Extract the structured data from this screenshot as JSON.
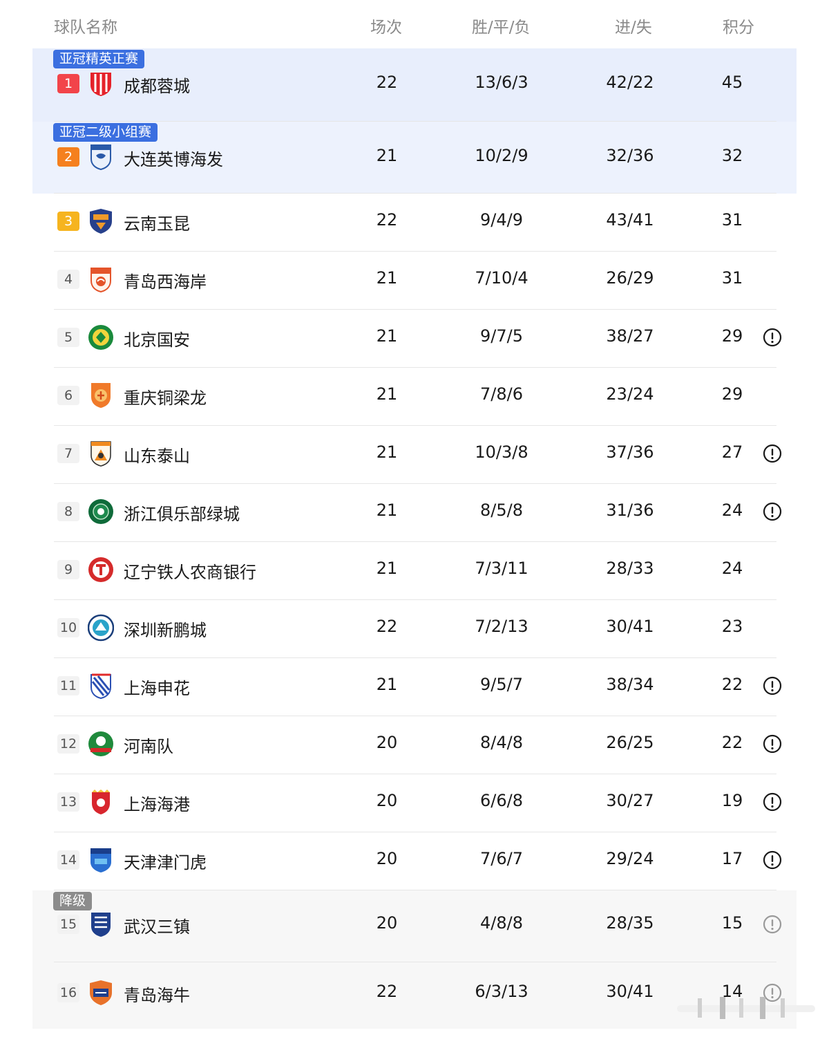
{
  "header": {
    "team": "球队名称",
    "played": "场次",
    "wdl": "胜/平/负",
    "goals": "进/失",
    "points": "积分"
  },
  "colors": {
    "acl_elite_bg": "#e8eefc",
    "acl_two_bg": "#edf2fd",
    "relegation_bg": "#f7f7f7",
    "tag_blue": "#3b6fe0",
    "tag_gray": "#8c8c8c",
    "rank1": "#f2444a",
    "rank2": "#f5801e",
    "rank3": "#f6b41f",
    "info_icon": "#1a1a1a",
    "info_icon_muted": "#9a9a9a"
  },
  "teams": [
    {
      "rank": "1",
      "name": "成都蓉城",
      "played": "22",
      "wdl": "13/6/3",
      "goals": "42/22",
      "points": "45",
      "zone": "亚冠精英正赛",
      "info": false,
      "logo": "chengdu-rongcheng-logo"
    },
    {
      "rank": "2",
      "name": "大连英博海发",
      "played": "21",
      "wdl": "10/2/9",
      "goals": "32/36",
      "points": "32",
      "zone": "亚冠二级小组赛",
      "info": false,
      "logo": "dalian-yingbo-logo"
    },
    {
      "rank": "3",
      "name": "云南玉昆",
      "played": "22",
      "wdl": "9/4/9",
      "goals": "43/41",
      "points": "31",
      "zone": "",
      "info": false,
      "logo": "yunnan-yukun-logo"
    },
    {
      "rank": "4",
      "name": "青岛西海岸",
      "played": "21",
      "wdl": "7/10/4",
      "goals": "26/29",
      "points": "31",
      "zone": "",
      "info": false,
      "logo": "qingdao-west-coast-logo"
    },
    {
      "rank": "5",
      "name": "北京国安",
      "played": "21",
      "wdl": "9/7/5",
      "goals": "38/27",
      "points": "29",
      "zone": "",
      "info": true,
      "logo": "beijing-guoan-logo"
    },
    {
      "rank": "6",
      "name": "重庆铜梁龙",
      "played": "21",
      "wdl": "7/8/6",
      "goals": "23/24",
      "points": "29",
      "zone": "",
      "info": false,
      "logo": "chongqing-tongliangloong-logo"
    },
    {
      "rank": "7",
      "name": "山东泰山",
      "played": "21",
      "wdl": "10/3/8",
      "goals": "37/36",
      "points": "27",
      "zone": "",
      "info": true,
      "logo": "shandong-taishan-logo"
    },
    {
      "rank": "8",
      "name": "浙江俱乐部绿城",
      "played": "21",
      "wdl": "8/5/8",
      "goals": "31/36",
      "points": "24",
      "zone": "",
      "info": true,
      "logo": "zhejiang-greentown-logo"
    },
    {
      "rank": "9",
      "name": "辽宁铁人农商银行",
      "played": "21",
      "wdl": "7/3/11",
      "goals": "28/33",
      "points": "24",
      "zone": "",
      "info": false,
      "logo": "liaoning-tieren-logo"
    },
    {
      "rank": "10",
      "name": "深圳新鹏城",
      "played": "22",
      "wdl": "7/2/13",
      "goals": "30/41",
      "points": "23",
      "zone": "",
      "info": false,
      "logo": "shenzhen-peng-city-logo"
    },
    {
      "rank": "11",
      "name": "上海申花",
      "played": "21",
      "wdl": "9/5/7",
      "goals": "38/34",
      "points": "22",
      "zone": "",
      "info": true,
      "logo": "shanghai-shenhua-logo"
    },
    {
      "rank": "12",
      "name": "河南队",
      "played": "20",
      "wdl": "8/4/8",
      "goals": "26/25",
      "points": "22",
      "zone": "",
      "info": true,
      "logo": "henan-logo"
    },
    {
      "rank": "13",
      "name": "上海海港",
      "played": "20",
      "wdl": "6/6/8",
      "goals": "30/27",
      "points": "19",
      "zone": "",
      "info": true,
      "logo": "shanghai-port-logo"
    },
    {
      "rank": "14",
      "name": "天津津门虎",
      "played": "20",
      "wdl": "7/6/7",
      "goals": "29/24",
      "points": "17",
      "zone": "",
      "info": true,
      "logo": "tianjin-jinmen-tiger-logo"
    },
    {
      "rank": "15",
      "name": "武汉三镇",
      "played": "20",
      "wdl": "4/8/8",
      "goals": "28/35",
      "points": "15",
      "zone": "降级",
      "info": true,
      "logo": "wuhan-three-towns-logo"
    },
    {
      "rank": "16",
      "name": "青岛海牛",
      "played": "22",
      "wdl": "6/3/13",
      "goals": "30/41",
      "points": "14",
      "zone": "",
      "info": true,
      "logo": "qingdao-hainiu-logo"
    }
  ]
}
